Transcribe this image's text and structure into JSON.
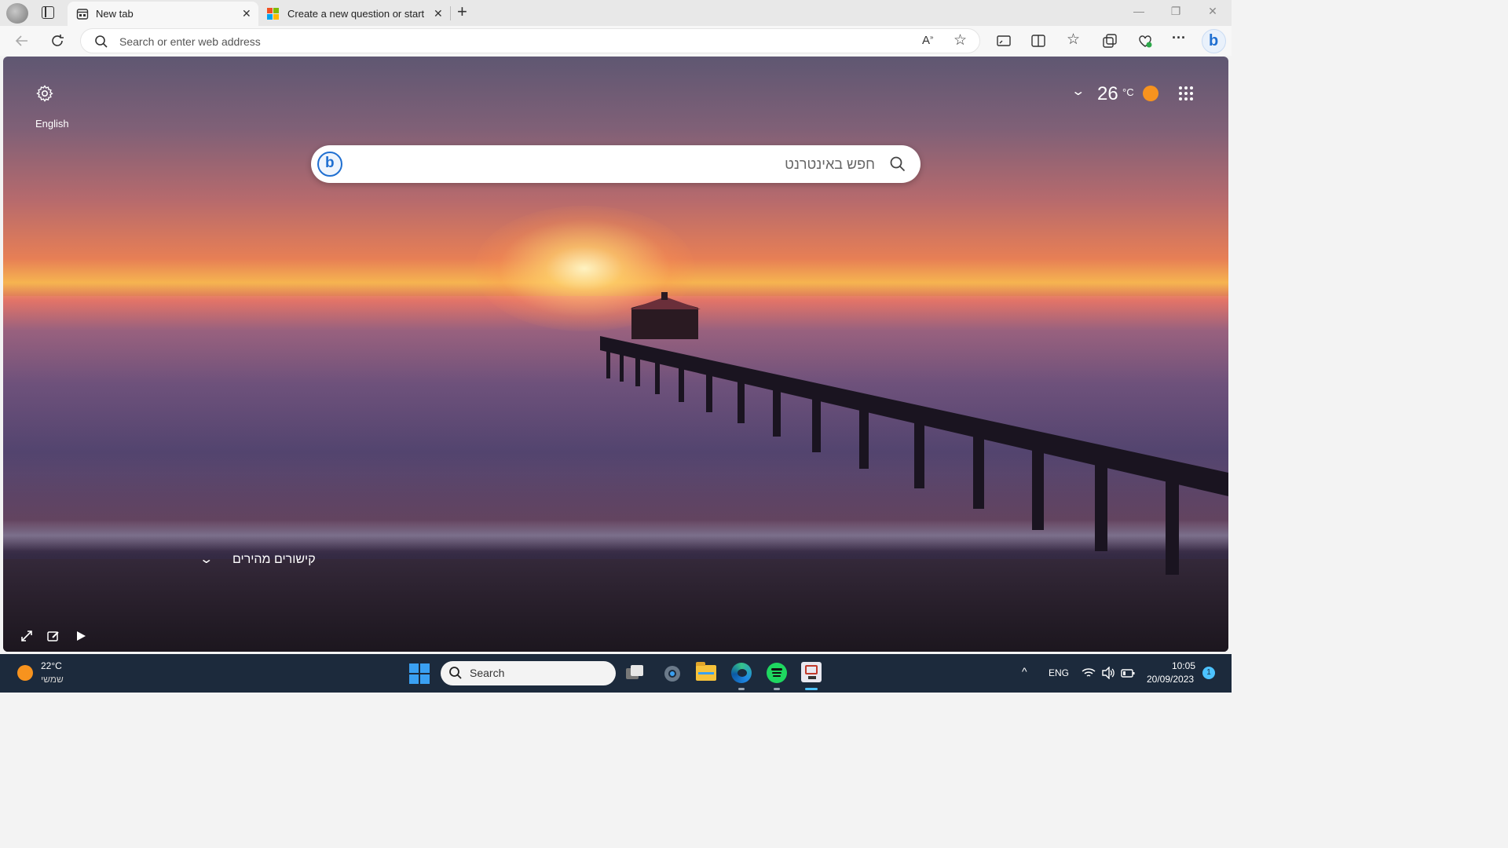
{
  "browser": {
    "tabs": [
      {
        "title": "New tab",
        "icon": "newtab-icon",
        "active": true
      },
      {
        "title": "Create a new question or start a",
        "icon": "microsoft-logo-icon",
        "active": false
      }
    ],
    "new_tab_label": "+",
    "address_placeholder": "Search or enter web address"
  },
  "newtab": {
    "language_label": "English",
    "temperature": "26",
    "temp_unit": "°C",
    "search_placeholder": "חפש באינטרנט",
    "quick_links_label": "קישורים מהירים"
  },
  "taskbar": {
    "weather_temp": "22°C",
    "weather_desc": "שמשי",
    "search_placeholder": "Search",
    "language": "ENG",
    "time": "10:05",
    "date": "20/09/2023",
    "notification_count": "1"
  },
  "colors": {
    "taskbar_bg": "#1c2a3c",
    "accent_blue": "#1f6fd1",
    "sun_orange": "#f7931e"
  }
}
